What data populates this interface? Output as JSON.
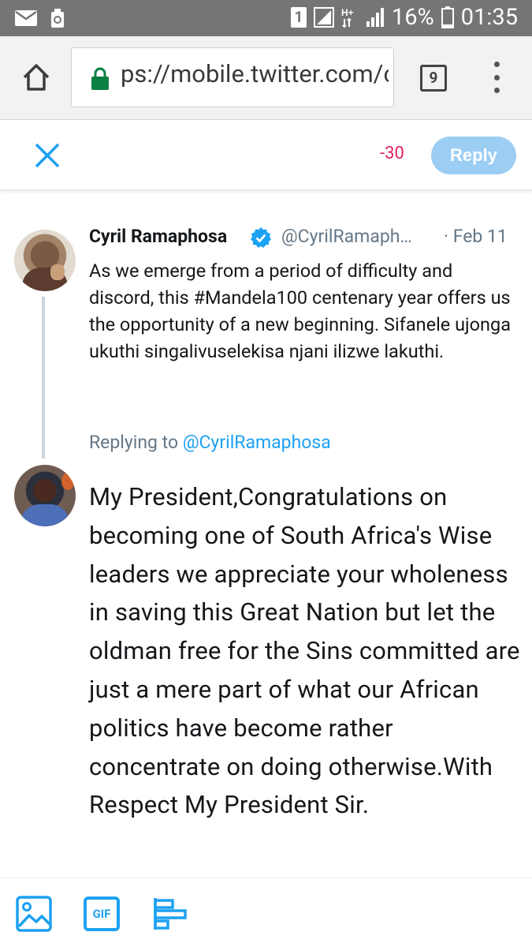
{
  "status_bar": {
    "sim_badge": "1",
    "network_label": "H+",
    "battery_percent": "16%",
    "time": "01:35"
  },
  "browser": {
    "url": "ps://mobile.twitter.com/c",
    "tab_count": "9"
  },
  "compose_header": {
    "char_count": "-30",
    "reply_label": "Reply"
  },
  "original_tweet": {
    "author_name": "Cyril Ramaphosa",
    "author_handle": "@CyrilRamaph…",
    "date": "· Feb 11",
    "text": "As we emerge from a period of difficulty and discord, this #Mandela100 centenary year offers us the opportunity of a new beginning. Sifanele ujonga ukuthi singalivuselekisa njani ilizwe lakuthi."
  },
  "reply": {
    "replying_to_label": "Replying to",
    "replying_to_handle": "@CyrilRamaphosa",
    "draft_text": "My President,Congratulations on becoming one of South Africa's Wise leaders we appreciate your wholeness in saving this Great Nation but let the oldman free for the Sins committed are just a mere part of what our African politics have become rather concentrate on doing otherwise.With Respect My President Sir."
  },
  "toolbar": {
    "gif_label": "GIF"
  },
  "icons": {
    "status_left": [
      "mail-icon",
      "recycle-icon"
    ],
    "status_right": [
      "sim-icon",
      "signal-icon",
      "network-icon",
      "signal-icon",
      "battery-icon"
    ],
    "browser": [
      "home-icon",
      "lock-icon",
      "tabs-icon",
      "menu-icon"
    ],
    "compose": [
      "close-icon",
      "verified-icon"
    ],
    "toolbar": [
      "image-icon",
      "gif-icon",
      "poll-icon"
    ]
  },
  "colors": {
    "accent": "#1da1f2",
    "reply_button_disabled": "#9ccef4",
    "char_count_over": "#e0245e",
    "secure_lock": "#0b8043",
    "status_bar": "#757575"
  }
}
